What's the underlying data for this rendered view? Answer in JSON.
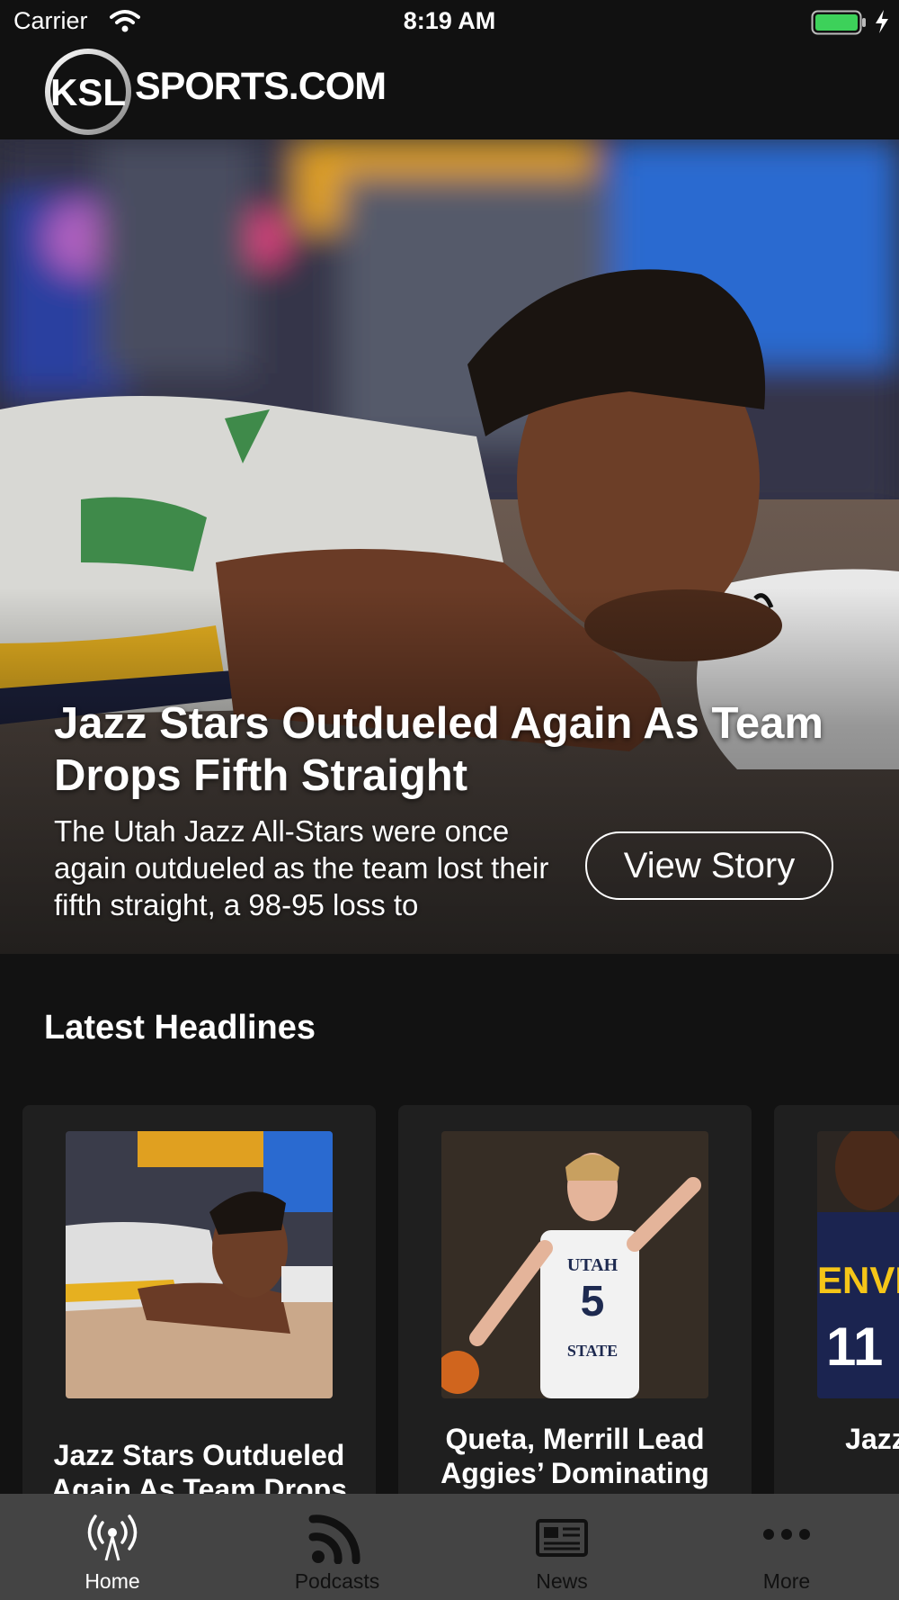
{
  "status_bar": {
    "carrier": "Carrier",
    "time": "8:19 AM"
  },
  "header": {
    "logo_mark": "KSL",
    "logo_text": "SPORTS.COM"
  },
  "hero": {
    "title": "Jazz Stars Outdueled Again As Team Drops Fifth Straight",
    "summary": "The Utah Jazz All-Stars were once again outdueled as the team lost their fifth straight, a 98-95 loss to",
    "button_label": "View Story"
  },
  "latest": {
    "title": "Latest Headlines",
    "cards": [
      {
        "title": "Jazz Stars Outdueled Again As Team Drops"
      },
      {
        "title": "Queta, Merrill Lead Aggies’ Dominating"
      },
      {
        "title": "Jazz Un Out Nu"
      }
    ]
  },
  "tabs": [
    {
      "label": "Home",
      "icon": "broadcast-icon",
      "active": true
    },
    {
      "label": "Podcasts",
      "icon": "rss-icon",
      "active": false
    },
    {
      "label": "News",
      "icon": "newspaper-icon",
      "active": false
    },
    {
      "label": "More",
      "icon": "more-icon",
      "active": false
    }
  ],
  "colors": {
    "background": "#121212",
    "tab_bar": "#444444",
    "battery": "#3DD15A"
  }
}
